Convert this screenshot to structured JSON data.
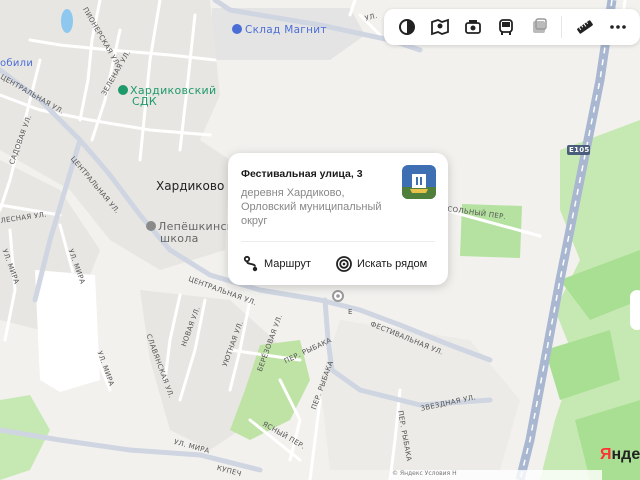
{
  "map": {
    "place_name": "Хардиково",
    "pois": {
      "warehouse": "Склад Магнит",
      "culture_house_line1": "Хардиковский",
      "culture_house_line2": "СДК",
      "school_line1": "Лепёшкинская",
      "school_line2": "школа",
      "edge_left": "обили"
    },
    "highway_shield": "E105",
    "streets": {
      "pionerskaya": "ПИОНЕРСКАЯ УЛ.",
      "zelenaya": "ЗЕЛЕНАЯ УЛ.",
      "centralnaya_nw": "ЦЕНТРАЛЬНАЯ УЛ.",
      "centralnaya_mid": "ЦЕНТРАЛЬНАЯ УЛ.",
      "centralnaya_s": "ЦЕНТРАЛЬНАЯ УЛ.",
      "sadovaya": "САДОВАЯ УЛ.",
      "lesnaya": "ЛЕСНАЯ УЛ.",
      "mira_w": "УЛ. МИРА",
      "mira_mid": "УЛ. МИРА",
      "mira_s": "УЛ. МИРА",
      "novaya": "НОВАЯ УЛ.",
      "slavyanskaya": "СЛАВЯНСКАЯ УЛ.",
      "uyutnaya": "УЮТНАЯ УЛ.",
      "berezovaya": "БЕРЁЗОВАЯ УЛ.",
      "rybaka": "ПЕР. РЫБАКА",
      "rybaka_s": "ПЕР. РЫБАКА",
      "festivalnaya": "ФЕСТИВАЛЬНАЯ УЛ.",
      "zvezdnaya": "ЗВЕЗДНАЯ УЛ.",
      "yasny": "ЯСНЫЙ ПЕР.",
      "kupecheskaya": "КУПЕЧ",
      "rybaka_top": "УЛ. РЫБАКА",
      "sobolny": "СОЛЬНЫЙ ПЕР.",
      "ul_top": "УЛ.",
      "ul_top2": "УЛ. ХА",
      "edge_e": "Е"
    }
  },
  "toolbar": {
    "buttons": [
      "layers-icon",
      "panorama-icon",
      "photo-icon",
      "transit-icon",
      "traffic-icon",
      "ruler-icon",
      "more-icon"
    ]
  },
  "popup": {
    "title": "Фестивальная улица, 3",
    "address": "деревня Хардиково, Орловский муниципальный округ",
    "route_label": "Маршрут",
    "nearby_label": "Искать рядом"
  },
  "footer": {
    "copyright": "© Яндекс  Условия  Н"
  },
  "logo": {
    "text_red": "Я",
    "text_dark": "нде"
  },
  "colors": {
    "land": "#f2f1ee",
    "block": "#e9e7e3",
    "road": "#ffffff",
    "main_road": "#c9d1de",
    "highway": "#a9b7d0",
    "green": "#bfe6a8",
    "green_dark": "#9fd98a",
    "water": "#8ec8ef",
    "industrial": "#e4e4e4",
    "poi_green": "#1f9a6a",
    "poi_blue": "#4b6ed6"
  }
}
